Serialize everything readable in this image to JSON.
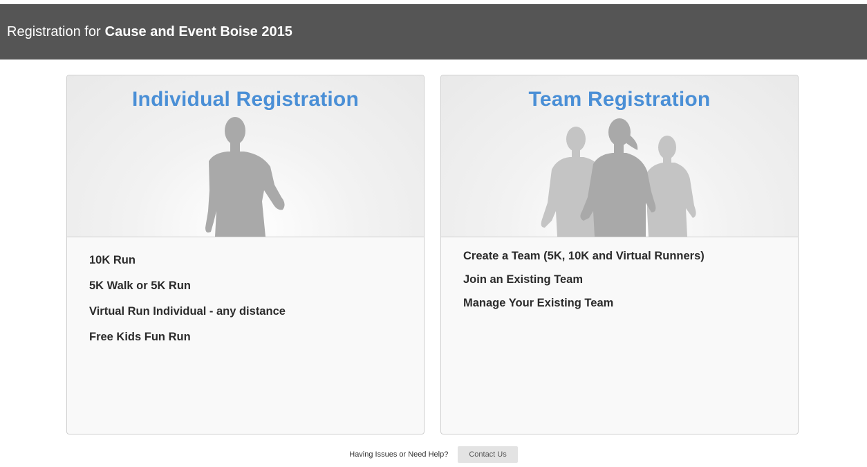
{
  "header": {
    "prefix": "Registration for",
    "event_name": "Cause and Event Boise 2015"
  },
  "individual": {
    "title": "Individual Registration",
    "options": [
      "10K Run",
      "5K Walk or 5K Run",
      "Virtual Run Individual - any distance",
      "Free Kids Fun Run"
    ]
  },
  "team": {
    "title": "Team Registration",
    "options": [
      "Create a Team (5K, 10K and Virtual Runners)",
      "Join an Existing Team",
      "Manage Your Existing Team"
    ]
  },
  "help": {
    "text": "Having Issues or Need Help?",
    "button_label": "Contact Us"
  },
  "colors": {
    "header_bg": "#555555",
    "title_blue": "#4a8fd6",
    "runner_gray": "#a9a9a9",
    "runner_gray_light": "#c4c4c4"
  },
  "icons": {
    "individual_hero": "runner-silhouette-icon",
    "team_hero": "team-runners-silhouette-icon"
  }
}
